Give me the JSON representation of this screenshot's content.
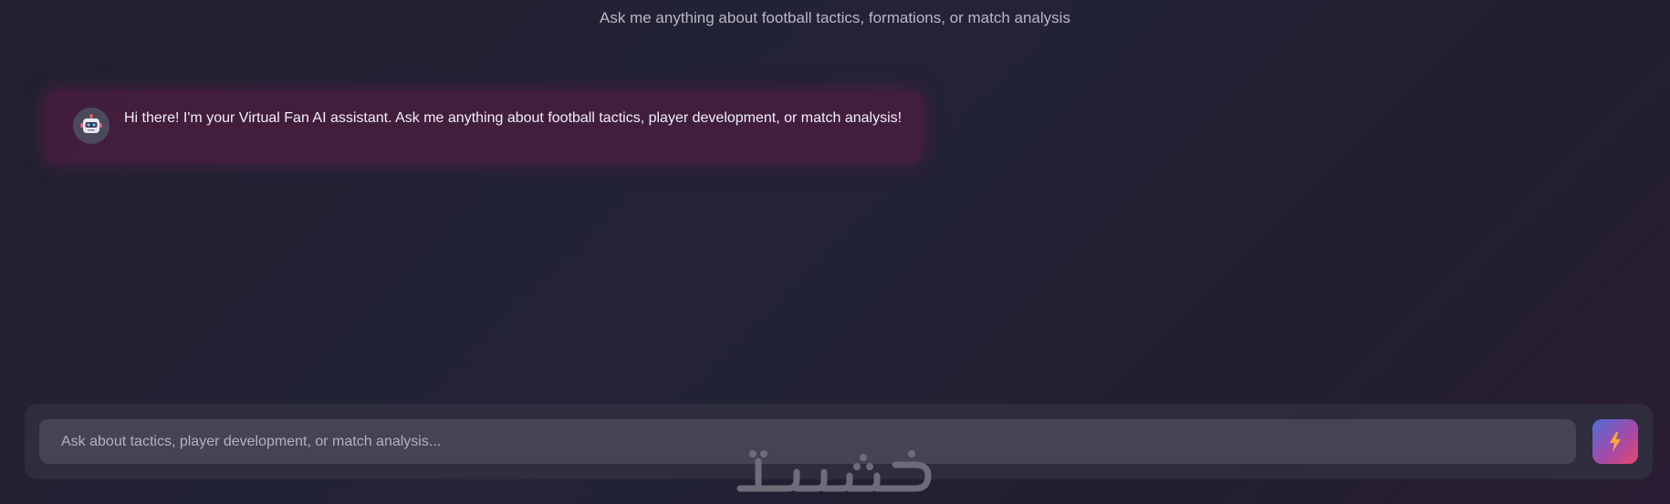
{
  "header": {
    "subtitle": "Ask me anything about football tactics, formations, or match analysis"
  },
  "messages": [
    {
      "role": "assistant",
      "avatar_icon": "robot-icon",
      "text": "Hi there! I'm your Virtual Fan AI assistant. Ask me anything about football tactics, player development, or match analysis!"
    }
  ],
  "composer": {
    "placeholder": "Ask about tactics, player development, or match analysis...",
    "value": "",
    "send_icon": "lightning-bolt-icon"
  },
  "watermark": {
    "text": "خمسات",
    "icon": "khamsat-logo"
  },
  "colors": {
    "background": "#22212f",
    "message_bubble": "#5c1c46",
    "input_field": "#454453",
    "send_gradient_start": "#4f6fd6",
    "send_gradient_end": "#e8466f",
    "send_icon": "#f6a93b"
  }
}
